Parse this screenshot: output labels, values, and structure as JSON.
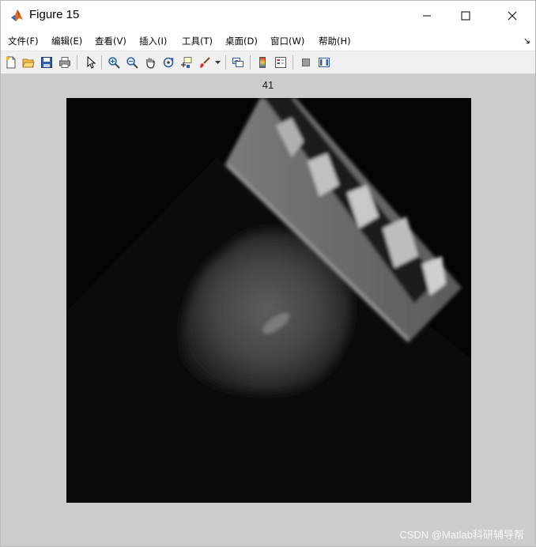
{
  "window": {
    "title": "Figure 15",
    "icon": "matlab-icon",
    "controls": [
      "minimize-icon",
      "maximize-icon",
      "close-icon"
    ]
  },
  "menubar": {
    "items": [
      {
        "label": "文件(F)"
      },
      {
        "label": "编辑(E)"
      },
      {
        "label": "查看(V)"
      },
      {
        "label": "插入(I)"
      },
      {
        "label": "工具(T)"
      },
      {
        "label": "桌面(D)"
      },
      {
        "label": "窗口(W)"
      },
      {
        "label": "帮助(H)"
      }
    ],
    "overflow_glyph": "↘"
  },
  "toolbar": {
    "buttons": [
      "new-figure-icon",
      "open-file-icon",
      "save-icon",
      "print-icon",
      "pointer-icon",
      "zoom-in-icon",
      "zoom-out-icon",
      "pan-hand-icon",
      "rotate-3d-icon",
      "data-cursor-icon",
      "brush-icon",
      "brush-dropdown-icon",
      "link-plot-icon",
      "colorbar-icon",
      "legend-icon",
      "hide-plot-tools-icon",
      "show-plot-tools-icon"
    ]
  },
  "figure": {
    "axes_title": "41",
    "watermark": "CSDN @Matlab科研辅导帮",
    "background_color": "#cccccc"
  }
}
